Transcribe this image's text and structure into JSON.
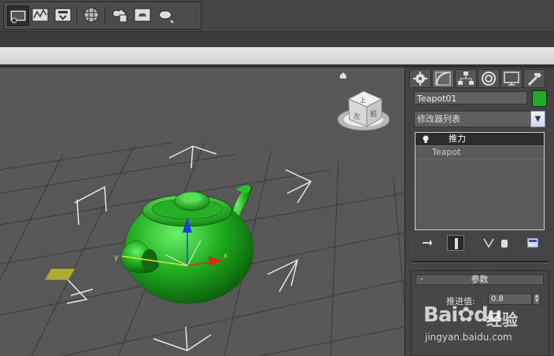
{
  "panel": {
    "object_name": "Teapot01",
    "object_color": "#22aa22",
    "modifier_list_label": "修改器列表",
    "stack": [
      {
        "label": "推力",
        "selected": true
      },
      {
        "label": "Teapot",
        "selected": false
      }
    ],
    "rollout": {
      "collapse_symbol": "-",
      "title": "参数",
      "param_label": "推进值:",
      "param_value": "0.8"
    }
  },
  "viewcube": {
    "face_top": "上",
    "face_front": "前",
    "face_left": "左"
  },
  "viewport": {
    "axis_x_label": "x",
    "axis_y_label": "y"
  },
  "watermark": {
    "logo": "Bai",
    "logo_suffix": "du",
    "brand": "经验",
    "url": "jingyan.baidu.com"
  },
  "colors": {
    "teapot": "#1fae1f",
    "viewport_bg": "#575757",
    "grid": "#3c3c3c",
    "axis_x": "#d03020",
    "axis_y": "#e0e040",
    "axis_z": "#2040e0"
  },
  "icons": {
    "toolbar": [
      "render-setup-icon",
      "graph-editor-icon",
      "schematic-icon",
      "material-editor-icon",
      "render-frame-icon",
      "render-icon",
      "quick-render-icon"
    ],
    "panel_tabs": [
      "create-icon",
      "modify-icon",
      "hierarchy-icon",
      "motion-icon",
      "display-icon",
      "utilities-icon"
    ],
    "stack_tools": [
      "pin-stack-icon",
      "show-end-result-icon",
      "make-unique-icon",
      "remove-modifier-icon",
      "configure-modifier-sets-icon"
    ]
  }
}
